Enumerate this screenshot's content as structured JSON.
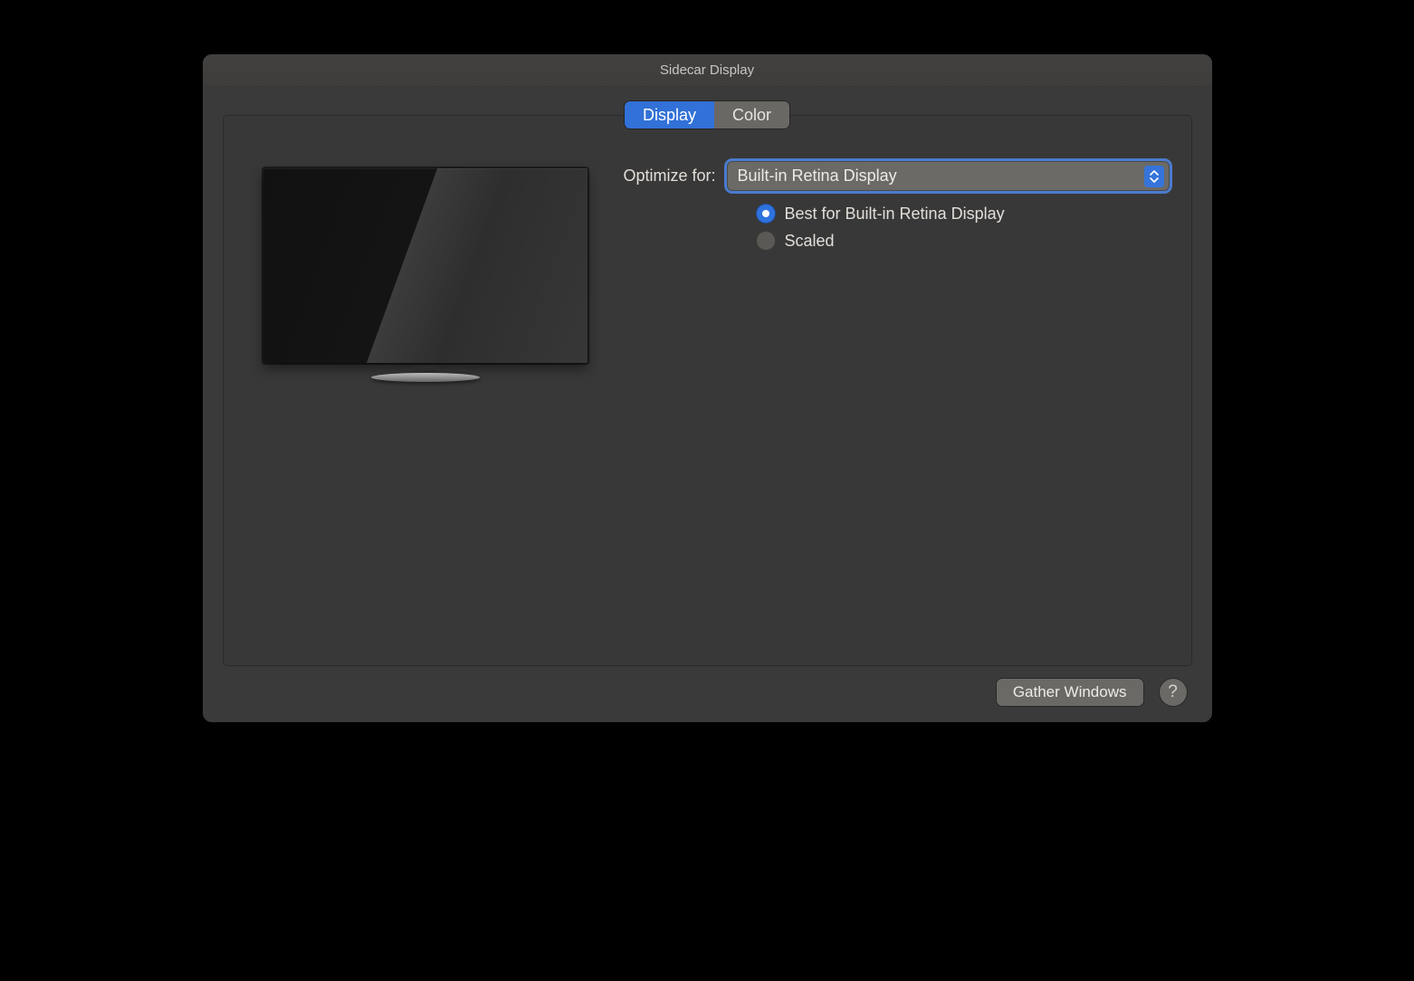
{
  "window": {
    "title": "Sidecar Display"
  },
  "tabs": {
    "display": "Display",
    "color": "Color",
    "active": "display"
  },
  "settings": {
    "optimize_label": "Optimize for:",
    "optimize_value": "Built-in Retina Display",
    "resolution_options": {
      "best": "Best for Built-in Retina Display",
      "scaled": "Scaled",
      "selected": "best"
    }
  },
  "footer": {
    "gather_windows": "Gather Windows",
    "help": "?"
  }
}
